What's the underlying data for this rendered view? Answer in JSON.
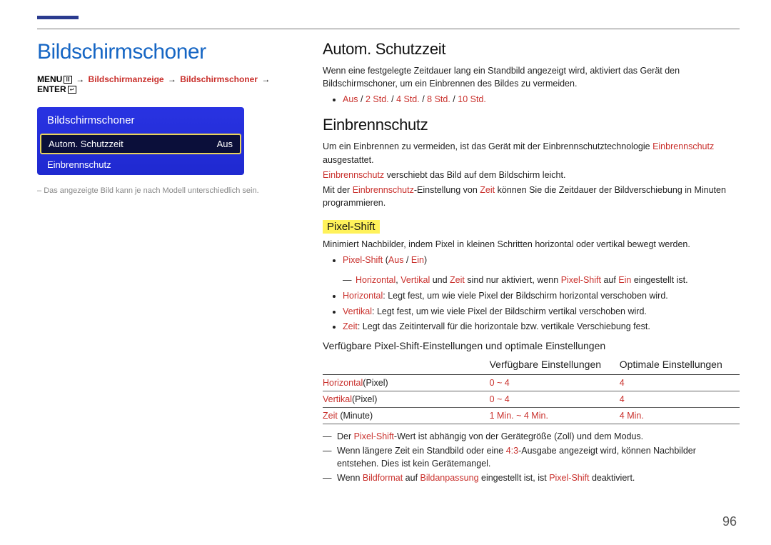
{
  "page_number": "96",
  "left": {
    "title": "Bildschirmschoner",
    "breadcrumb": {
      "menu": "MENU",
      "menu_glyph": "Ⅲ",
      "crumb1": "Bildschirmanzeige",
      "crumb2": "Bildschirmschoner",
      "enter": "ENTER",
      "enter_glyph": "↵"
    },
    "menu": {
      "title": "Bildschirmschoner",
      "rows": [
        {
          "label": "Autom. Schutzzeit",
          "value": "Aus",
          "selected": true
        },
        {
          "label": "Einbrennschutz",
          "value": "",
          "selected": false
        }
      ]
    },
    "caption": "Das angezeigte Bild kann je nach Modell unterschiedlich sein."
  },
  "right": {
    "sec1": {
      "heading": "Autom. Schutzzeit",
      "para": "Wenn eine festgelegte Zeitdauer lang ein Standbild angezeigt wird, aktiviert das Gerät den Bildschirmschoner, um ein Einbrennen des Bildes zu vermeiden.",
      "options": {
        "o1": "Aus",
        "o2": "2 Std.",
        "o3": "4 Std.",
        "o4": "8 Std.",
        "o5": "10 Std.",
        "slash": " / "
      }
    },
    "sec2": {
      "heading": "Einbrennschutz",
      "p1a": "Um ein Einbrennen zu vermeiden, ist das Gerät mit der Einbrennschutztechnologie ",
      "p1b": "Einbrennschutz",
      "p1c": " ausgestattet.",
      "p2a": "Einbrennschutz",
      "p2b": " verschiebt das Bild auf dem Bildschirm leicht.",
      "p3a": "Mit der ",
      "p3b": "Einbrennschutz",
      "p3c": "-Einstellung von ",
      "p3d": "Zeit",
      "p3e": " können Sie die Zeitdauer der Bildverschiebung in Minuten programmieren."
    },
    "pixel": {
      "heading": "Pixel-Shift",
      "intro": "Minimiert Nachbilder, indem Pixel in kleinen Schritten horizontal oder vertikal bewegt werden.",
      "b1": {
        "label": "Pixel-Shift",
        "paren_open": " (",
        "opt1": "Aus",
        "sep": " / ",
        "opt2": "Ein",
        "paren_close": ")"
      },
      "note": {
        "a": "Horizontal",
        "b": ", ",
        "c": "Vertikal",
        "d": " und ",
        "e": "Zeit",
        "f": " sind nur aktiviert, wenn ",
        "g": "Pixel-Shift",
        "h": " auf ",
        "i": "Ein",
        "j": " eingestellt ist."
      },
      "b2": {
        "label": "Horizontal",
        "text": ": Legt fest, um wie viele Pixel der Bildschirm horizontal verschoben wird."
      },
      "b3": {
        "label": "Vertikal",
        "text": ": Legt fest, um wie viele Pixel der Bildschirm vertikal verschoben wird."
      },
      "b4": {
        "label": "Zeit",
        "text": ": Legt das Zeitintervall für die horizontale bzw. vertikale Verschiebung fest."
      }
    },
    "table": {
      "heading": "Verfügbare Pixel-Shift-Einstellungen und optimale Einstellungen",
      "h1": "",
      "h2": "Verfügbare Einstellungen",
      "h3": "Optimale Einstellungen",
      "rows": [
        {
          "a1": "Horizontal",
          "a2": "(Pixel)",
          "b": "0 ~ 4",
          "c": "4"
        },
        {
          "a1": "Vertikal",
          "a2": "(Pixel)",
          "b": "0 ~ 4",
          "c": "4"
        },
        {
          "a1": "Zeit",
          "a2": " (Minute)",
          "b": "1 Min. ~ 4 Min.",
          "c": "4 Min."
        }
      ]
    },
    "notes": {
      "n1": {
        "a": "Der ",
        "b": "Pixel-Shift",
        "c": "-Wert ist abhängig von der Gerätegröße (Zoll) und dem Modus."
      },
      "n2": {
        "a": "Wenn längere Zeit ein Standbild oder eine ",
        "b": "4:3",
        "c": "-Ausgabe angezeigt wird, können Nachbilder entstehen. Dies ist kein Gerätemangel."
      },
      "n3": {
        "a": "Wenn ",
        "b": "Bildformat",
        "c": " auf ",
        "d": "Bildanpassung",
        "e": " eingestellt ist, ist ",
        "f": "Pixel-Shift",
        "g": " deaktiviert."
      }
    }
  }
}
